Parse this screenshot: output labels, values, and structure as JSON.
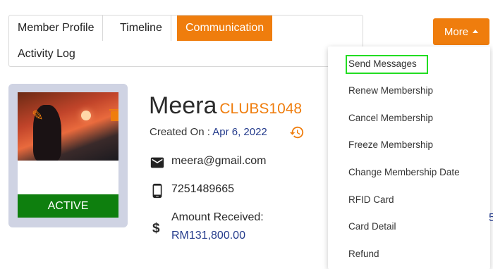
{
  "tabs": {
    "member_profile": "Member Profile",
    "timeline": "Timeline",
    "communication": "Communication",
    "activity_log": "Activity Log",
    "active_tab": "Communication"
  },
  "more_button": {
    "label": "More"
  },
  "profile": {
    "status": "ACTIVE",
    "name": "Meera",
    "code": "CLUBS1048",
    "created_label": "Created On : ",
    "created_date": "Apr 6, 2022",
    "email": "meera@gmail.com",
    "phone": "7251489665",
    "amount_label": "Amount Received:",
    "amount_value": "RM131,800.00"
  },
  "dropdown": {
    "items": [
      "Send Messages",
      "Renew Membership",
      "Cancel Membership",
      "Freeze Membership",
      "Change Membership Date",
      "RFID Card",
      "Card Detail",
      "Refund"
    ],
    "highlighted": "Send Messages"
  },
  "edge_text": "5",
  "colors": {
    "accent": "#ef7d0d",
    "status_green": "#0e7f0e",
    "link_blue": "#243b8c",
    "card_bg": "#cfd3e3",
    "highlight": "#22dd22"
  },
  "icons": [
    "edit-icon",
    "trash-icon",
    "history-icon",
    "mail-icon",
    "phone-icon",
    "dollar-icon",
    "caret-up-icon"
  ]
}
